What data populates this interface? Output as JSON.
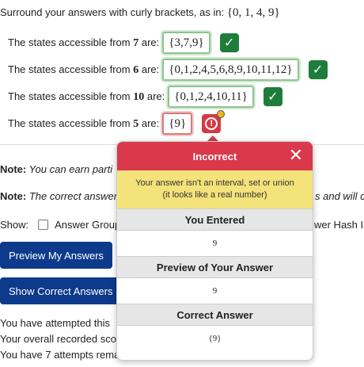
{
  "intro": {
    "text": "Surround your answers with curly brackets, as in: ",
    "example": "{0, 1, 4, 9}"
  },
  "rows": [
    {
      "prefix": "The states accessible from ",
      "state": "7",
      "suffix": " are:",
      "answer": "{3,7,9}",
      "status": "correct"
    },
    {
      "prefix": "The states accessible from ",
      "state": "6",
      "suffix": " are:",
      "answer": "{0,1,2,4,5,6,8,9,10,11,12}",
      "status": "correct"
    },
    {
      "prefix": "The states accessible from ",
      "state": "10",
      "suffix": " are:",
      "answer": "{0,1,2,4,10,11}",
      "status": "correct"
    },
    {
      "prefix": "The states accessible from ",
      "state": "5",
      "suffix": " are:",
      "answer": "{9}",
      "status": "error"
    }
  ],
  "icons": {
    "correct": "check-icon",
    "error": "exclamation-circle-icon",
    "close": "close-icon"
  },
  "notes": {
    "note1_label": "Note:",
    "note1_text": " You can earn parti",
    "note2_label": "Note:",
    "note2_text": " The correct answer",
    "note2_tail": "s and will c"
  },
  "show": {
    "label": "Show:",
    "option1": "Answer Group",
    "option2_tail": "wer Hash I"
  },
  "buttons": {
    "preview": "Preview My Answers",
    "show_correct": "Show Correct Answers"
  },
  "attempts": {
    "line1": "You have attempted this",
    "line2": "Your overall recorded sco",
    "line3": "You have 7 attempts rema"
  },
  "popover": {
    "title": "Incorrect",
    "close": "✕",
    "message_line1": "Your answer isn't an interval, set or union",
    "message_line2": "(it looks like a real number)",
    "you_entered_h": "You Entered",
    "you_entered_v": "9",
    "preview_h": "Preview of Your Answer",
    "preview_v": "9",
    "correct_h": "Correct Answer",
    "correct_v": "{9}"
  },
  "colors": {
    "correct_bg": "#1e7d3b",
    "error_bg": "#d23b46",
    "popover_header": "#d9394b",
    "popover_message": "#f4e27a",
    "button_bg": "#0d3a8a"
  }
}
